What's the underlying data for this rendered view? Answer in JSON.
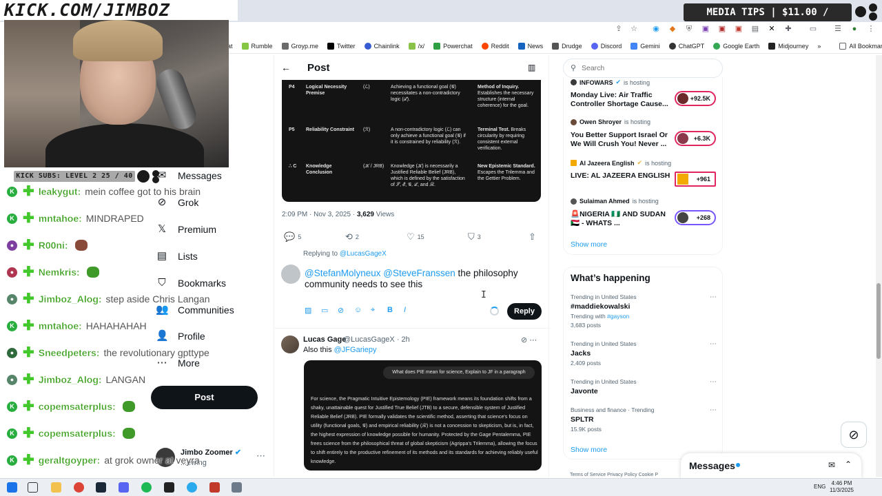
{
  "stream": {
    "banner": "KICK.COM/JIMBOZ",
    "media_tips": "MEDIA TIPS | $11.00 / $200.00",
    "kick_subs": "KICK SUBS: LEVEL 2 25 / 40"
  },
  "bookmarks": [
    "at",
    "Rumble",
    "Groyp.me",
    "Twitter",
    "Chainlink",
    "/x/",
    "Powerchat",
    "Reddit",
    "News",
    "Drudge",
    "Discord",
    "Gemini",
    "ChatGPT",
    "Google Earth",
    "Midjourney"
  ],
  "all_bookmarks": "All Bookmarks",
  "chat": [
    {
      "user": "leakygut:",
      "msg": "mein coffee got to his brain",
      "badge_color": "#27ae3e",
      "badge": "K"
    },
    {
      "user": "mntahoe:",
      "msg": "MINDRAPED",
      "badge_color": "#27ae3e",
      "badge": "K"
    },
    {
      "user": "R00ni:",
      "msg": "",
      "badge_color": "#7d3fa0",
      "badge": "●"
    },
    {
      "user": "Nemkris:",
      "msg": "",
      "badge_color": "#b03550",
      "badge": "●"
    },
    {
      "user": "Jimboz_Alog:",
      "msg": "step aside Chris Langan",
      "badge_color": "#56856a",
      "badge": "●"
    },
    {
      "user": "mntahoe:",
      "msg": "HAHAHAHAH",
      "badge_color": "#27ae3e",
      "badge": "K"
    },
    {
      "user": "Sneedpeters:",
      "msg": "the revolutionary gpttype",
      "badge_color": "#2f6a3c",
      "badge": "●"
    },
    {
      "user": "Jimboz_Alog:",
      "msg": "LANGAN",
      "badge_color": "#56856a",
      "badge": "●"
    },
    {
      "user": "copemsaterplus:",
      "msg": "",
      "badge_color": "#27ae3e",
      "badge": "K"
    },
    {
      "user": "copemsaterplus:",
      "msg": "",
      "badge_color": "#27ae3e",
      "badge": "K"
    },
    {
      "user": "geraltgoyper:",
      "msg": "at grok owner at veyra",
      "badge_color": "#27ae3e",
      "badge": "K"
    }
  ],
  "nav": {
    "messages": "Messages",
    "grok": "Grok",
    "premium": "Premium",
    "lists": "Lists",
    "bookmarks": "Bookmarks",
    "communities": "Communities",
    "profile": "Profile",
    "more": "More",
    "post": "Post"
  },
  "account": {
    "name": "Jimbo Zoomer",
    "handle": "...ewing"
  },
  "post": {
    "header": "Post",
    "table_rows": [
      {
        "id": "P4",
        "name": "Logical Necessity Premise",
        "sym": "(ℒ)",
        "desc": "Achieving a functional goal (𝒢) necessitates a non-contradictory logic (ℒ).",
        "role_b": "Method of Inquiry.",
        "role": "Establishes the necessary structure (internal coherence) for the goal."
      },
      {
        "id": "P5",
        "name": "Reliability Constraint",
        "sym": "(ℛ)",
        "desc": "A non-contradictory logic (ℒ) can only achieve a functional goal (𝒢) if it is constrained by reliability (ℛ).",
        "role_b": "Terminal Test.",
        "role": "Breaks circularity by requiring consistent external verification."
      },
      {
        "id": "∴ C",
        "name": "Knowledge Conclusion",
        "sym": "(𝒦 / JRB)",
        "desc": "Knowledge (𝒦) is necessarily a Justified Reliable Belief (JRB), which is defined by the satisfaction of 𝒮, ℰ, 𝒢, ℒ, and ℛ.",
        "role_b": "New Epistemic Standard.",
        "role": "Escapes the Trilemma and the Gettier Problem."
      }
    ],
    "time": "2:09 PM · Nov 3, 2025 · ",
    "views": "3,629",
    "views_label": " Views",
    "replies": "5",
    "reposts": "2",
    "likes": "15",
    "bookmarks": "3"
  },
  "reply": {
    "replying_to_prefix": "Replying to ",
    "replying_to": "@LucasGageX",
    "mention1": "@StefanMolyneux",
    "mention2": "@SteveFranssen",
    "text": " the philosophy community needs to see this",
    "button": "Reply"
  },
  "tweet2": {
    "name": "Lucas Gage",
    "handle": "@LucasGageX · 2h",
    "text_prefix": "Also this ",
    "mention": "@JFGariepy",
    "question": "What does PIE mean for science, Explain to JF in a paragraph",
    "body": "For science, the Pragmatic Intuitive Epistemology (PIE) framework means its foundation shifts from a shaky, unattainable quest for Justified True Belief (JTB) to a secure, defensible system of Justified Reliable Belief (JRB). PIE formally validates the scientific method, asserting that science's focus on utility (functional goals, 𝒢) and empirical reliability (ℛ) is not a concession to skepticism, but is, in fact, the highest expression of knowledge possible for humanity. Protected by the Gage Pentalemma, PIE frees science from the philosophical threat of global skepticism (Agrippa's Trilemma), allowing the focus to shift entirely to the productive refinement of its methods and its standards for achieving reliably useful knowledge."
  },
  "search": {
    "placeholder": "Search"
  },
  "live": [
    {
      "host": "INFOWARS",
      "title": "Monday Live: Air Traffic Controller Shortage Cause...",
      "count": "+92.5K",
      "dot": "#3a3a3a"
    },
    {
      "host": "Owen Shroyer",
      "title": "You Better Support Israel Or We Will Crush You! Never ...",
      "count": "+6.3K",
      "dot": "#6a4a3a"
    },
    {
      "host": "Al Jazeera English",
      "title": "LIVE: AL JAZEERA ENGLISH",
      "count": "+961",
      "dot": "#f2a900"
    },
    {
      "host": "Sulaiman Ahmed",
      "title": "🚨NIGERIA 🇳🇬 AND SUDAN 🇸🇩 - WHATS ...",
      "count": "+268",
      "dot": "#555555"
    }
  ],
  "hosting_label": "is hosting",
  "show_more": "Show more",
  "trending": {
    "title": "What’s happening",
    "items": [
      {
        "ctx": "Trending in United States",
        "name": "#maddiekowalski",
        "sub_prefix": "Trending with ",
        "sub_link": "#gayson",
        "posts": "3,683 posts"
      },
      {
        "ctx": "Trending in United States",
        "name": "Jacks",
        "sub_prefix": "",
        "sub_link": "",
        "posts": "2,409 posts"
      },
      {
        "ctx": "Trending in United States",
        "name": "Javonte",
        "sub_prefix": "",
        "sub_link": "",
        "posts": ""
      },
      {
        "ctx": "Business and finance · Trending",
        "name": "SPLTR",
        "sub_prefix": "",
        "sub_link": "",
        "posts": "15.9K posts"
      }
    ]
  },
  "footer": "Terms of Service    Privacy Policy    Cookie P",
  "messages_drawer": "Messages",
  "tray": {
    "lang": "ENG",
    "time": "4:46 PM",
    "date": "11/3/2025"
  }
}
